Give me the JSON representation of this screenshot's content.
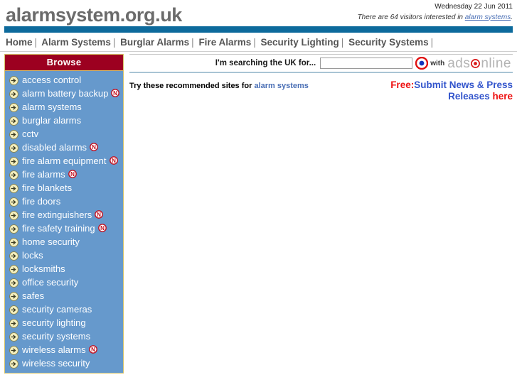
{
  "header": {
    "site_title": "alarmsystem.org.uk",
    "date": "Wednesday 22 Jun 2011",
    "visitors_prefix": "There are 64 visitors interested in ",
    "visitors_link": "alarm systems",
    "visitors_suffix": ".",
    "visitor_count": 64
  },
  "topnav": {
    "items": [
      {
        "label": "Home"
      },
      {
        "label": "Alarm Systems"
      },
      {
        "label": "Burglar Alarms"
      },
      {
        "label": "Fire Alarms"
      },
      {
        "label": "Security Lighting"
      },
      {
        "label": "Security Systems"
      }
    ],
    "separator": "|"
  },
  "sidebar": {
    "title": "Browse",
    "items": [
      {
        "label": "access control",
        "new": false
      },
      {
        "label": "alarm battery backup",
        "new": true
      },
      {
        "label": "alarm systems",
        "new": false
      },
      {
        "label": "burglar alarms",
        "new": false
      },
      {
        "label": "cctv",
        "new": false
      },
      {
        "label": "disabled alarms",
        "new": true
      },
      {
        "label": "fire alarm equipment",
        "new": true
      },
      {
        "label": "fire alarms",
        "new": true
      },
      {
        "label": "fire blankets",
        "new": false
      },
      {
        "label": "fire doors",
        "new": false
      },
      {
        "label": "fire extinguishers",
        "new": true
      },
      {
        "label": "fire safety training",
        "new": true
      },
      {
        "label": "home security",
        "new": false
      },
      {
        "label": "locks",
        "new": false
      },
      {
        "label": "locksmiths",
        "new": false
      },
      {
        "label": "office security",
        "new": false
      },
      {
        "label": "safes",
        "new": false
      },
      {
        "label": "security cameras",
        "new": false
      },
      {
        "label": "security lighting",
        "new": false
      },
      {
        "label": "security systems",
        "new": false
      },
      {
        "label": "wireless alarms",
        "new": true
      },
      {
        "label": "wireless security",
        "new": false
      }
    ],
    "new_badge_letter": "N"
  },
  "search": {
    "label": "I'm searching the UK for...",
    "value": "",
    "placeholder": "",
    "with_text": "with",
    "logo_part1": "ads",
    "logo_part2": "nline"
  },
  "content": {
    "recommend_prefix": "Try these recommended sites for ",
    "recommend_link": "alarm systems",
    "promo_line1_red": "Free:",
    "promo_line1_blue": "Submit News & Press",
    "promo_line2_blue": "Releases ",
    "promo_line2_red": "here"
  },
  "colors": {
    "nav_bar_blue": "#0d6a9c",
    "sidebar_bg": "#6699cc",
    "browse_header_red": "#9c0020",
    "sidebar_border_gold": "#d6c36a",
    "link_blue": "#4a6fb5",
    "promo_red": "#ee1111",
    "promo_blue": "#3355cc",
    "title_gray": "#6b6b6b"
  }
}
